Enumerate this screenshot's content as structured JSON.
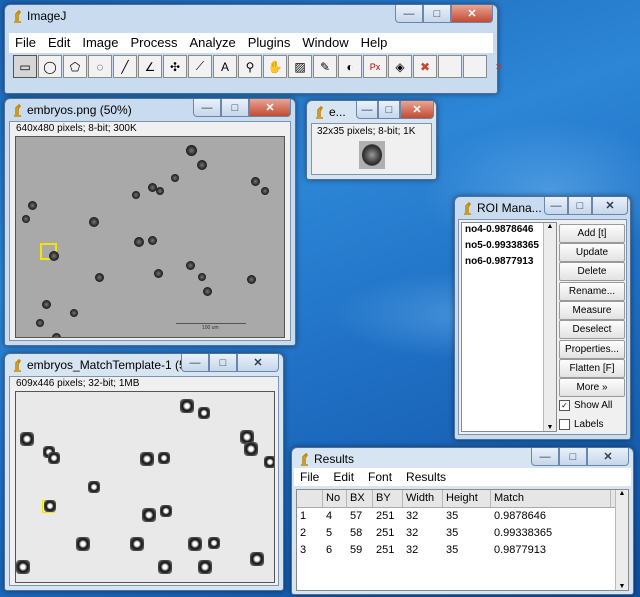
{
  "imagej": {
    "title": "ImageJ",
    "menu": [
      "File",
      "Edit",
      "Image",
      "Process",
      "Analyze",
      "Plugins",
      "Window",
      "Help"
    ],
    "tools": [
      {
        "name": "rectangle-tool-icon",
        "glyph": "▭"
      },
      {
        "name": "oval-tool-icon",
        "glyph": "◯"
      },
      {
        "name": "polygon-tool-icon",
        "glyph": "⬠"
      },
      {
        "name": "freehand-tool-icon",
        "glyph": "◌"
      },
      {
        "name": "line-tool-icon",
        "glyph": "╱"
      },
      {
        "name": "angle-tool-icon",
        "glyph": "∠"
      },
      {
        "name": "point-tool-icon",
        "glyph": "✣"
      },
      {
        "name": "wand-tool-icon",
        "glyph": "⟋"
      },
      {
        "name": "text-tool-icon",
        "glyph": "A"
      },
      {
        "name": "magnifier-tool-icon",
        "glyph": "⚲"
      },
      {
        "name": "hand-tool-icon",
        "glyph": "✋"
      },
      {
        "name": "dropper-tool-icon",
        "glyph": "▨"
      },
      {
        "name": "pencil-tool-icon",
        "glyph": "✎"
      },
      {
        "name": "brush-tool-icon",
        "glyph": "◐"
      },
      {
        "name": "px-tool-icon",
        "glyph": "Px"
      },
      {
        "name": "target-tool-icon",
        "glyph": "◈"
      },
      {
        "name": "stop-tool-icon",
        "glyph": "✖"
      },
      {
        "name": "empty-tool-1",
        "glyph": ""
      },
      {
        "name": "empty-tool-2",
        "glyph": ""
      },
      {
        "name": "more-tools-icon",
        "glyph": "»"
      }
    ]
  },
  "embryos": {
    "title": "embryos.png (50%)",
    "info": "640x480 pixels; 8-bit; 300K",
    "scalebar_label": "100 um"
  },
  "thumb": {
    "title": "e...",
    "info": "32x35 pixels; 8-bit; 1K"
  },
  "match": {
    "title": "embryos_MatchTemplate-1 (5...",
    "info": "609x446 pixels; 32-bit; 1MB"
  },
  "roi": {
    "title": "ROI Mana...",
    "items": [
      "no4-0.9878646",
      "no5-0.99338365",
      "no6-0.9877913"
    ],
    "buttons": [
      "Add [t]",
      "Update",
      "Delete",
      "Rename...",
      "Measure",
      "Deselect",
      "Properties...",
      "Flatten [F]",
      "More »"
    ],
    "show_all": {
      "label": "Show All",
      "checked": true
    },
    "labels": {
      "label": "Labels",
      "checked": false
    }
  },
  "results": {
    "title": "Results",
    "menu": [
      "File",
      "Edit",
      "Font",
      "Results"
    ],
    "columns": [
      "",
      "No",
      "BX",
      "BY",
      "Width",
      "Height",
      "Match"
    ],
    "rows": [
      [
        "1",
        "4",
        "57",
        "251",
        "32",
        "35",
        "0.9878646"
      ],
      [
        "2",
        "5",
        "58",
        "251",
        "32",
        "35",
        "0.99338365"
      ],
      [
        "3",
        "6",
        "59",
        "251",
        "32",
        "35",
        "0.9877913"
      ]
    ]
  },
  "window_controls": {
    "minimize": "—",
    "maximize": "□",
    "close": "✕"
  },
  "colors": {
    "roi_box": "#f5e400",
    "close_red": "#c24b32",
    "frame": "#c9dcef"
  }
}
